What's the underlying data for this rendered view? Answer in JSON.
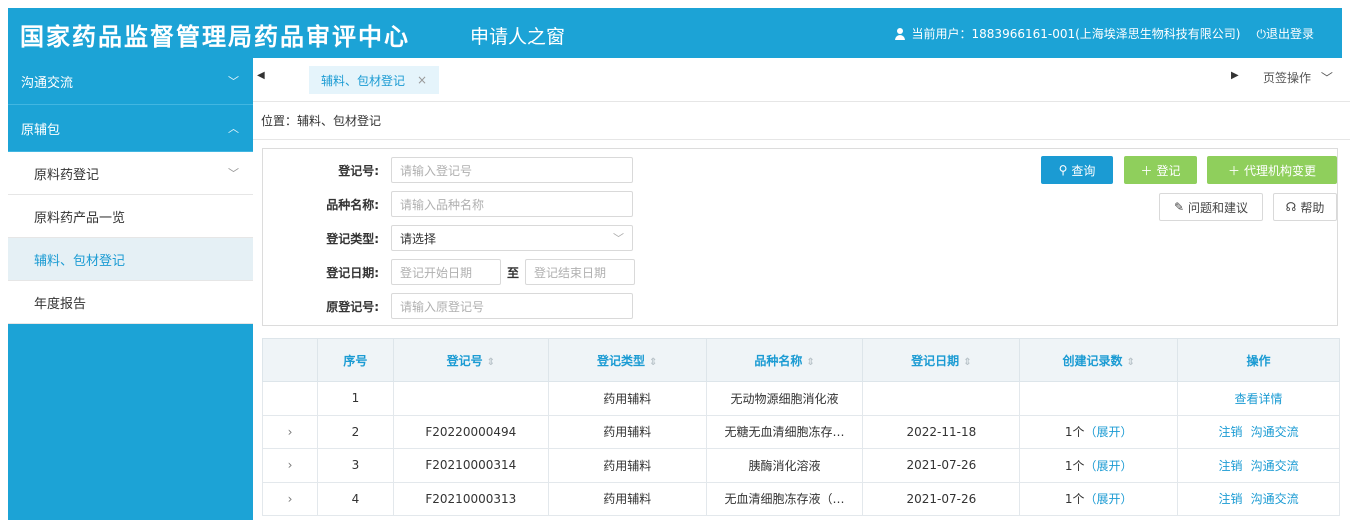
{
  "header": {
    "brand": "国家药品监督管理局药品审评中心",
    "portal": "申请人之窗",
    "user_label": "当前用户：1883966161-001(上海埃泽思生物科技有限公司)",
    "logout": "退出登录"
  },
  "sidebar": {
    "groups": [
      {
        "label": "沟通交流",
        "chevron": "chevron-down-icon"
      },
      {
        "label": "原辅包",
        "chevron": "chevron-up-icon"
      }
    ],
    "items": [
      {
        "label": "原料药登记",
        "chevron": "chevron-down-icon",
        "active": false
      },
      {
        "label": "原料药产品一览",
        "active": false
      },
      {
        "label": "辅料、包材登记",
        "active": true
      },
      {
        "label": "年度报告",
        "active": false
      }
    ]
  },
  "tabbar": {
    "active_tab": "辅料、包材登记",
    "close": "×",
    "ops": "页签操作"
  },
  "breadcrumb": "位置：辅料、包材登记",
  "search": {
    "fields": [
      {
        "label": "登记号:",
        "placeholder": "请输入登记号"
      },
      {
        "label": "品种名称:",
        "placeholder": "请输入品种名称"
      },
      {
        "label": "登记类型:",
        "placeholder": "请选择"
      },
      {
        "label": "登记日期:",
        "start_placeholder": "登记开始日期",
        "separator": "至",
        "end_placeholder": "登记结束日期"
      },
      {
        "label": "原登记号:",
        "placeholder": "请输入原登记号"
      }
    ],
    "buttons": {
      "query": "查询",
      "register": "登记",
      "agent_change": "代理机构变更",
      "feedback": "问题和建议",
      "help": "帮助"
    }
  },
  "table": {
    "columns": [
      "序号",
      "登记号",
      "登记类型",
      "品种名称",
      "登记日期",
      "创建记录数",
      "操作"
    ],
    "rows": [
      {
        "index": "1",
        "reg_no": "",
        "type": "药用辅料",
        "name": "无动物源细胞消化液",
        "date": "",
        "count": "",
        "expand": "",
        "actions": [
          "查看详情"
        ],
        "has_toggle": false
      },
      {
        "index": "2",
        "reg_no": "F20220000494",
        "type": "药用辅料",
        "name": "无糖无血清细胞冻存…",
        "date": "2022-11-18",
        "count": "1个",
        "expand": "（展开）",
        "actions": [
          "注销",
          "沟通交流"
        ],
        "has_toggle": true
      },
      {
        "index": "3",
        "reg_no": "F20210000314",
        "type": "药用辅料",
        "name": "胰酶消化溶液",
        "date": "2021-07-26",
        "count": "1个",
        "expand": "（展开）",
        "actions": [
          "注销",
          "沟通交流"
        ],
        "has_toggle": true
      },
      {
        "index": "4",
        "reg_no": "F20210000313",
        "type": "药用辅料",
        "name": "无血清细胞冻存液（…",
        "date": "2021-07-26",
        "count": "1个",
        "expand": "（展开）",
        "actions": [
          "注销",
          "沟通交流"
        ],
        "has_toggle": true
      }
    ]
  },
  "colors": {
    "brand_blue": "#1ca3d6",
    "link_blue": "#1b9bd3",
    "green": "#8fcf5c"
  }
}
